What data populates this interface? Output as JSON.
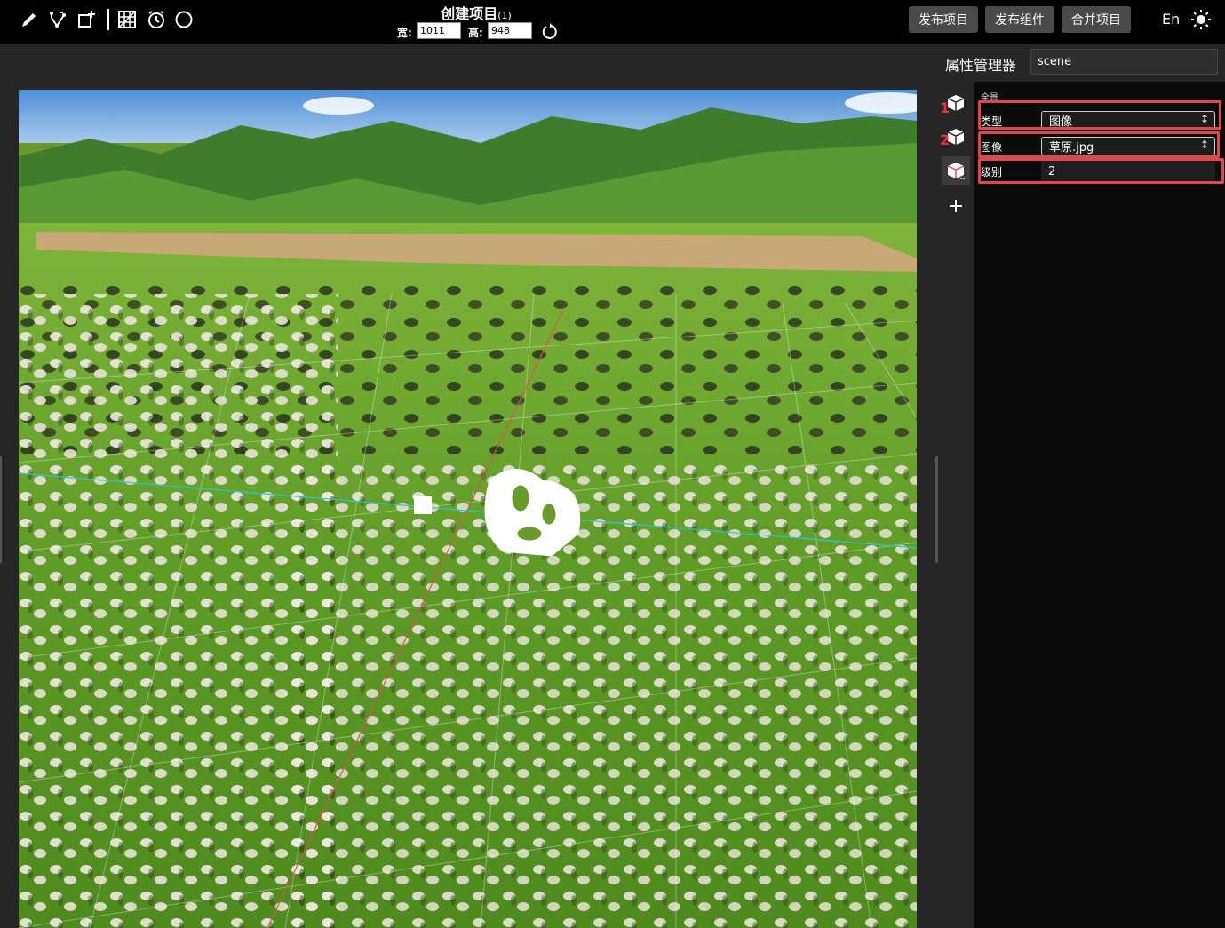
{
  "toolbar": {
    "icons": [
      "pencil-icon",
      "edit-path-icon",
      "add-layer-icon",
      "grid-icon",
      "timer-icon",
      "circle-icon"
    ]
  },
  "project": {
    "title": "创建项目",
    "count": "(1)",
    "width_label": "宽:",
    "width_value": "1011",
    "height_label": "高:",
    "height_value": "948"
  },
  "actions": {
    "publish_project": "发布项目",
    "publish_component": "发布组件",
    "merge_project": "合并项目",
    "language": "En"
  },
  "properties": {
    "title": "属性管理器",
    "scene_name": "scene",
    "section_label": "全景",
    "rows": [
      {
        "label": "类型",
        "value": "图像",
        "kind": "select"
      },
      {
        "label": "图像",
        "value": "草原.jpg",
        "kind": "select"
      },
      {
        "label": "级别",
        "value": "2",
        "kind": "text"
      }
    ]
  },
  "side_markers": [
    "1",
    "2"
  ],
  "colors": {
    "highlight": "#e0474c",
    "accent_axis_red": "#d9534f",
    "accent_axis_cyan": "#2ec4d6"
  }
}
